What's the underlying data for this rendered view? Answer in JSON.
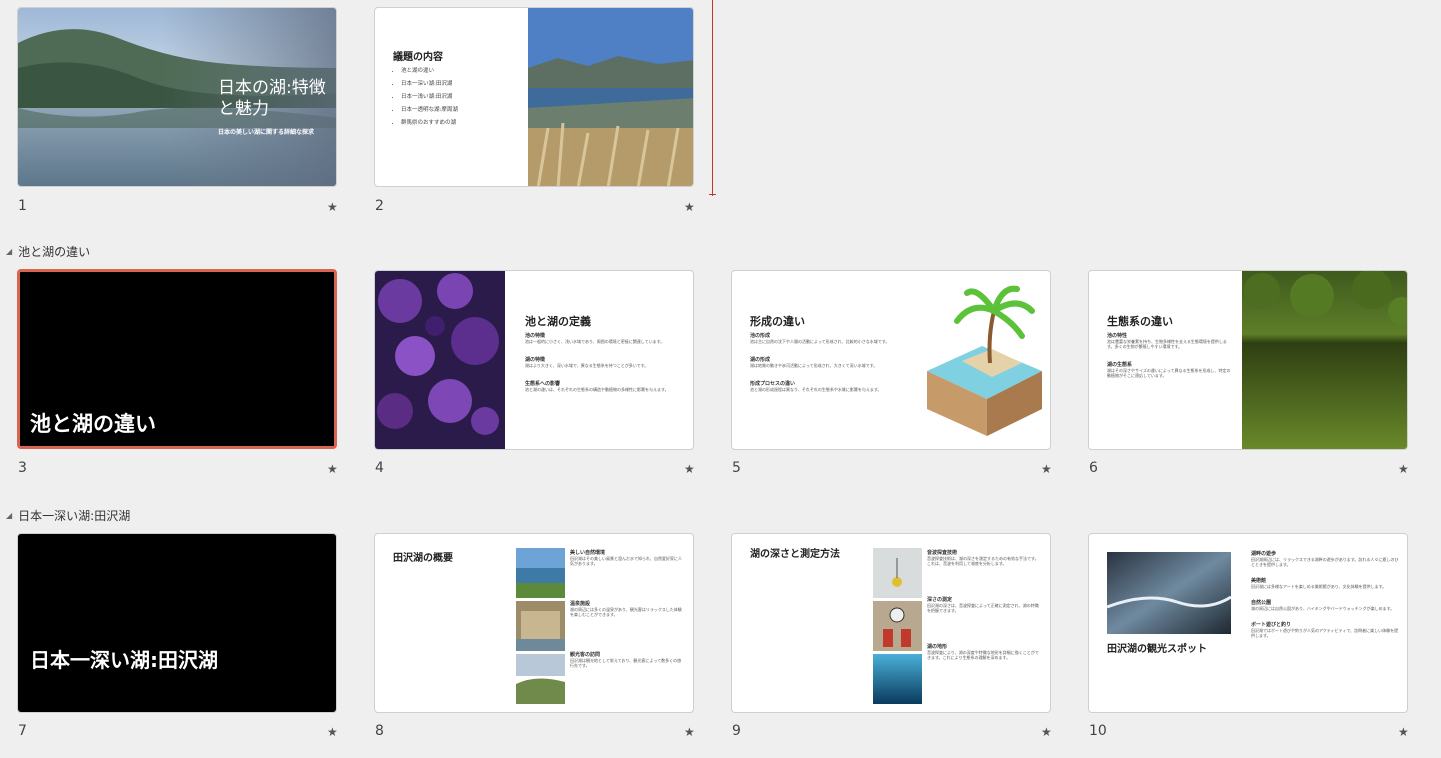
{
  "sections": [
    {
      "title": "池と湖の違い"
    },
    {
      "title": "日本一深い湖:田沢湖"
    }
  ],
  "slide_numbers": [
    "1",
    "2",
    "3",
    "4",
    "5",
    "6",
    "7",
    "8",
    "9",
    "10"
  ],
  "star_glyph": "★",
  "slides": {
    "s1": {
      "title": "日本の湖:特徴と魅力",
      "subtitle": "日本の美しい湖に関する詳細な探求"
    },
    "s2": {
      "title": "議題の内容",
      "bullets": [
        "池と湖の違い",
        "日本一深い湖:田沢湖",
        "日本一浅い湖:田沢湖",
        "日本一透明な湖:摩周湖",
        "群馬県のおすすめの湖"
      ]
    },
    "s3": {
      "title": "池と湖の違い"
    },
    "s4": {
      "title": "池と湖の定義",
      "items": [
        {
          "h": "池の特徴",
          "t": "池は一般的に小さく、浅い水域であり、周囲の環境と密接に関連しています。"
        },
        {
          "h": "湖の特徴",
          "t": "湖はより大きく、深い水域で、異なる生態系を持つことが多いです。"
        },
        {
          "h": "生態系への影響",
          "t": "池と湖の違いは、それぞれの生態系の構造や動植物の多様性に影響を与えます。"
        }
      ]
    },
    "s5": {
      "title": "形成の違い",
      "items": [
        {
          "h": "池の形成",
          "t": "池は主に自然の沈下や人間の活動によって形成され、比較的小さな水域です。"
        },
        {
          "h": "湖の形成",
          "t": "湖は地質の動きや氷河活動によって形成され、大きくて深い水域です。"
        },
        {
          "h": "形成プロセスの違い",
          "t": "池と湖の形成過程は異なり、それぞれの生態系や水質に影響を与えます。"
        }
      ]
    },
    "s6": {
      "title": "生態系の違い",
      "items": [
        {
          "h": "池の特性",
          "t": "池は豊富な栄養素を持ち、生物多様性を支える生態環境を提供します。多くの生物が繁殖しやすい環境です。"
        },
        {
          "h": "湖の生態系",
          "t": "湖はその深さやサイズの違いによって異なる生態系を形成し、特定の動植物がそこに適応しています。"
        }
      ]
    },
    "s7": {
      "title": "日本一深い湖:田沢湖"
    },
    "s8": {
      "title": "田沢湖の概要",
      "items": [
        {
          "h": "美しい自然環境",
          "t": "田沢湖はその美しい風景と澄んだ水で知られ、自然愛好家に人気があります。"
        },
        {
          "h": "温泉施設",
          "t": "湖の周辺には多くの温泉があり、観光客はリラックスした体験を楽しむことができます。"
        },
        {
          "h": "観光客の訪問",
          "t": "田沢湖は観光地として栄えており、観光客によって数多くの旅行先です。"
        }
      ]
    },
    "s9": {
      "title": "湖の深さと測定方法",
      "items": [
        {
          "h": "音波探査技術",
          "t": "音波探査技術は、湖の深さを測定するための有効な手法です。これは、音波を利用して湖底を分析します。"
        },
        {
          "h": "深さの測定",
          "t": "田沢湖の深さは、音波探査によって正確に測定され、湖の特徴を把握できます。"
        },
        {
          "h": "湖の地形",
          "t": "音波探査により、湖の深度や特徴な地形を詳細に描くことができます。これにより生態系の理解を深めます。"
        }
      ]
    },
    "s10": {
      "title": "田沢湖の観光スポット",
      "items": [
        {
          "h": "湖畔の遊歩",
          "t": "田沢湖周辺には、リラックスできる湖畔の遊歩があります。訪れる人々に癒しのひとときを提供します。"
        },
        {
          "h": "美術館",
          "t": "田沢湖には多様なアートを楽しめる美術館があり、文化体験を提供します。"
        },
        {
          "h": "自然公園",
          "t": "湖の周辺には自然公園があり、ハイキングやバードウォッチングが楽しめます。"
        },
        {
          "h": "ボート遊びと釣り",
          "t": "田沢湖ではボート遊びや釣りが人気のアクティビティで、訪問者に楽しい体験を提供します。"
        }
      ]
    }
  }
}
